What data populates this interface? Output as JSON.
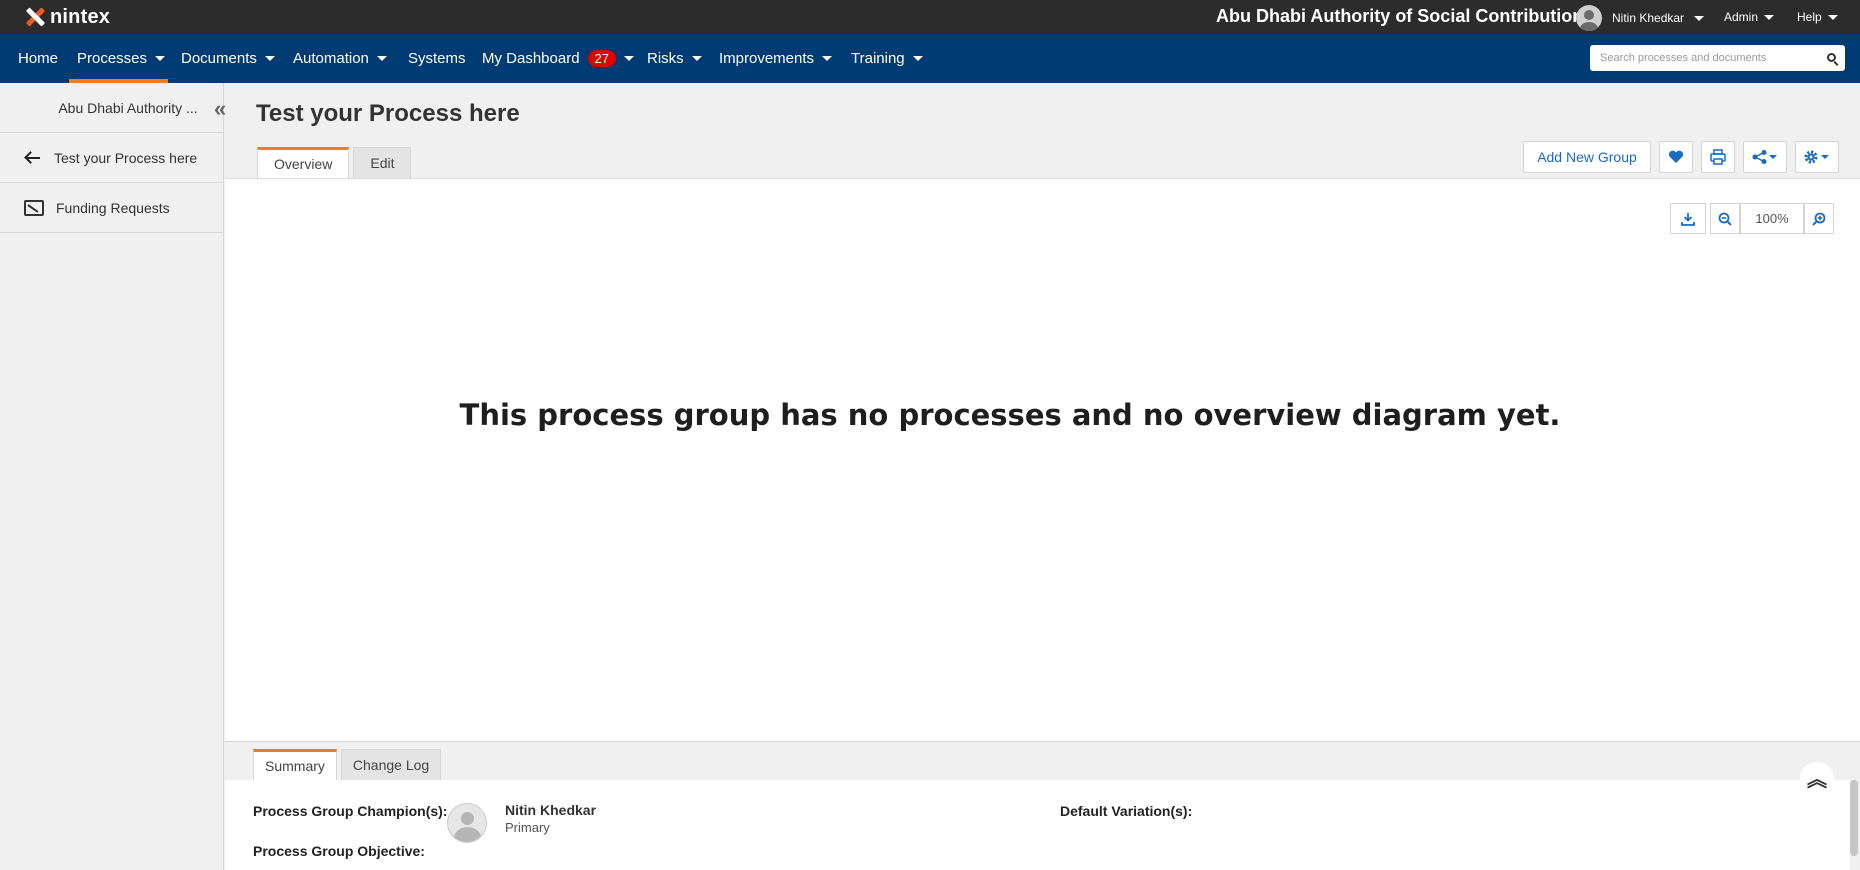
{
  "brand": {
    "logo_text": "nintex",
    "org_title": "Abu Dhabi Authority of Social Contribution"
  },
  "user_menu": {
    "user_name": "Nitin Khedkar",
    "admin_label": "Admin",
    "help_label": "Help"
  },
  "nav": {
    "items": [
      {
        "label": "Home"
      },
      {
        "label": "Processes",
        "active": true
      },
      {
        "label": "Documents"
      },
      {
        "label": "Automation"
      },
      {
        "label": "Systems"
      },
      {
        "label": "My Dashboard",
        "badge": "27"
      },
      {
        "label": "Risks"
      },
      {
        "label": "Improvements"
      },
      {
        "label": "Training"
      }
    ],
    "search_placeholder": "Search processes and documents"
  },
  "sidebar": {
    "root_label": "Abu Dhabi Authority ...",
    "back_label": "Test your Process here",
    "items": [
      {
        "label": "Funding Requests",
        "icon": "process-group-icon"
      }
    ]
  },
  "page": {
    "title": "Test your Process here",
    "tabs": [
      {
        "label": "Overview",
        "active": true
      },
      {
        "label": "Edit"
      }
    ],
    "toolbar": {
      "add_group_label": "Add New Group"
    },
    "zoom_level": "100%",
    "empty_message": "This process group has no processes and no overview diagram yet."
  },
  "summary": {
    "tabs": [
      {
        "label": "Summary",
        "active": true
      },
      {
        "label": "Change Log"
      }
    ],
    "champion_label": "Process Group Champion(s):",
    "champion_name": "Nitin Khedkar",
    "champion_role": "Primary",
    "objective_label": "Process Group Objective:",
    "default_variation_label": "Default Variation(s):"
  },
  "colors": {
    "topbar": "#2c2c2c",
    "navbar": "#003b73",
    "accent": "#f47a20",
    "link_blue": "#1a6bbf",
    "badge_red": "#e00000"
  }
}
